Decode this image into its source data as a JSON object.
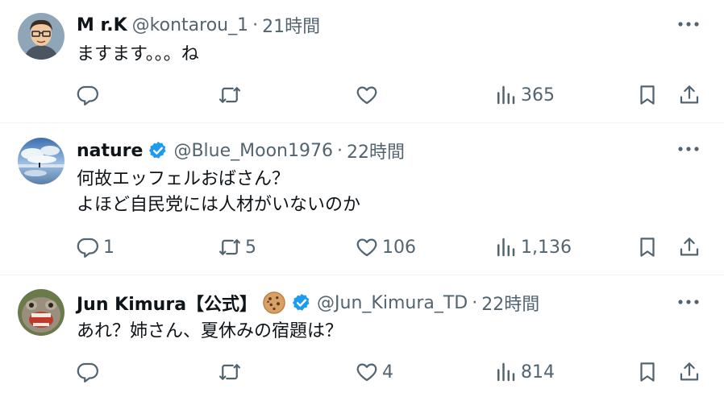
{
  "posts": [
    {
      "name": "M r.K",
      "verified": false,
      "handle": "@kontarou_1",
      "separator": "·",
      "time": "21時間",
      "text": "ますます。。。ね",
      "replies": "",
      "reposts": "",
      "likes": "",
      "views": "365",
      "avatar": "cartoon-man-avatar"
    },
    {
      "name": "nature",
      "verified": true,
      "handle": "@Blue_Moon1976",
      "separator": "·",
      "time": "22時間",
      "text": "何故エッフェルおばさん？\nよほど自民党には人材がいないのか",
      "replies": "1",
      "reposts": "5",
      "likes": "106",
      "views": "1,136",
      "avatar": "sky-landscape-avatar"
    },
    {
      "name": "Jun Kimura【公式】",
      "verified": true,
      "badge": "cookie-emoji",
      "handle": "@Jun_Kimura_TD",
      "separator": "·",
      "time": "22時間",
      "text": "あれ？姉さん、夏休みの宿題は？",
      "replies": "",
      "reposts": "",
      "likes": "4",
      "views": "814",
      "avatar": "shisa-statue-avatar"
    }
  ],
  "colors": {
    "text": "#0f1419",
    "muted": "#536471",
    "verified": "#1d9bf0",
    "divider": "#eff3f4"
  }
}
